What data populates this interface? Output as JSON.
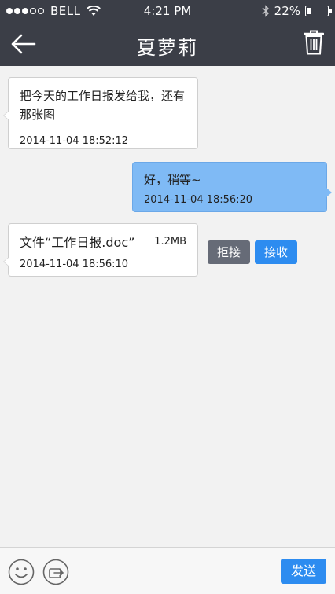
{
  "status_bar": {
    "signal_filled": 3,
    "signal_total": 5,
    "carrier": "BELL",
    "time": "4:21 PM",
    "battery": "22%",
    "battery_level": 0.22
  },
  "header": {
    "title": "夏萝莉"
  },
  "messages": [
    {
      "direction": "incoming",
      "text": "把今天的工作日报发给我，还有那张图",
      "time": "2014-11-04 18:52:12"
    },
    {
      "direction": "outgoing",
      "text": "好，稍等~",
      "time": "2014-11-04 18:56:20"
    },
    {
      "direction": "incoming",
      "type": "file",
      "file_name": "文件“工作日报.doc”",
      "file_size": "1.2MB",
      "time": "2014-11-04 18:56:10"
    }
  ],
  "file_actions": {
    "reject_label": "拒接",
    "accept_label": "接收"
  },
  "input_bar": {
    "input_value": "",
    "send_label": "发送"
  },
  "colors": {
    "bar_background": "#3b3e47",
    "outgoing_bubble": "#7fbaf5",
    "accent_blue": "#2d8cf0",
    "reject_gray": "#666b77"
  },
  "icons": [
    "wifi-icon",
    "bluetooth-icon",
    "battery-icon",
    "back-arrow-icon",
    "trash-icon",
    "emoji-icon",
    "share-icon"
  ]
}
